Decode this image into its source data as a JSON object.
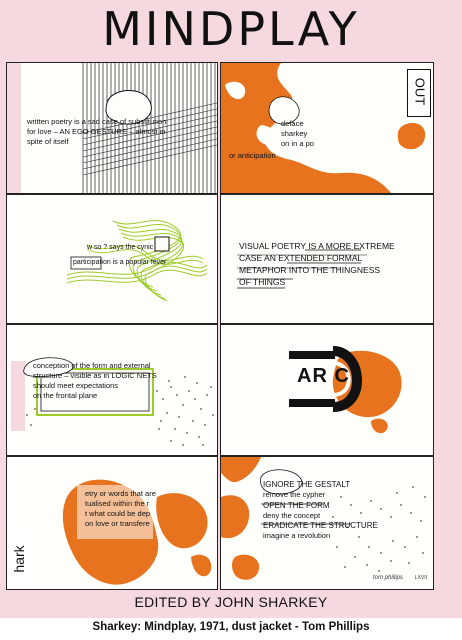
{
  "title": "MINDPLAY",
  "editor_line": "EDITED BY JOHN SHARKEY",
  "caption": "Sharkey: Mindplay, 1971, dust jacket - Tom Phillips",
  "panels": {
    "p1": {
      "lines": [
        "written poetry is a sad case of substitution",
        "for love – AN EGO GESTURE – almost in",
        "spite of itself"
      ]
    },
    "p2": {
      "out_label": "OUT",
      "lines": [
        "deface",
        "sharkey",
        "on in a po",
        "or anticipation"
      ]
    },
    "p3": {
      "lines": [
        "w so ? says the cynic",
        "participation is a popular fever"
      ]
    },
    "p4": {
      "lines": [
        "VISUAL POETRY IS A MORE EXTREME",
        "CASE AN EXTENDED FORMAL",
        "METAPHOR INTO THE THINGNESS",
        "OF THINGS"
      ]
    },
    "p5": {
      "lines": [
        "conception of the form and external",
        "structure – visible as in LOGIC NETS",
        "should meet expectations",
        "on the frontal plane"
      ]
    },
    "p6": {
      "arc_label": "AR C"
    },
    "p7": {
      "hark_label": "hark",
      "lines": [
        "etry or words that are",
        "tualised within the r",
        "t what could be dep",
        "on love or transfere"
      ]
    },
    "p8": {
      "lines": [
        "IGNORE THE GESTALT",
        "remove the cypher",
        "OPEN THE FORM",
        "deny the concept",
        "ERADICATE THE STRUCTURE",
        "imagine a revolution"
      ],
      "signature": "tom phillips",
      "date": "LXVII"
    }
  },
  "colors": {
    "background": "#f6d9df",
    "orange": "#e8731f",
    "green": "#9ccc2a",
    "ink": "#111111"
  }
}
